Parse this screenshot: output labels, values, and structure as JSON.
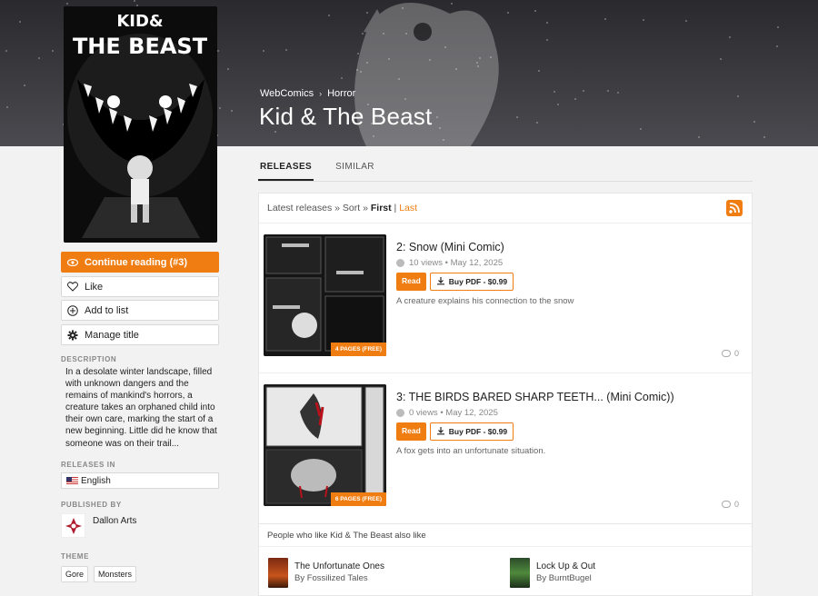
{
  "hero": {
    "breadcrumb": [
      "WebComics",
      "Horror"
    ],
    "title": "Kid & The Beast"
  },
  "cover": {
    "title_art_lines": [
      "KID&",
      "THE BEAST"
    ]
  },
  "actions": {
    "continue_label": "Continue reading (#3)",
    "like_label": "Like",
    "add_list_label": "Add to list",
    "manage_label": "Manage title"
  },
  "sidebar": {
    "description_label": "DESCRIPTION",
    "description": "In a desolate winter landscape, filled with unknown dangers and the remains of mankind's horrors, a creature takes an orphaned child into their own care, marking the start of a new beginning. Little did he know that someone was on their trail...",
    "releases_in_label": "RELEASES IN",
    "language": "English",
    "published_by_label": "PUBLISHED BY",
    "publisher": "Dallon Arts",
    "theme_label": "THEME",
    "tags": [
      "Gore",
      "Monsters"
    ]
  },
  "tabs": [
    {
      "label": "RELEASES",
      "active": true
    },
    {
      "label": "SIMILAR",
      "active": false
    }
  ],
  "releases_header": {
    "latest": "Latest releases",
    "sep1": "»",
    "sort": "Sort",
    "sep2": "»",
    "first": "First",
    "divider": "|",
    "last": "Last"
  },
  "releases": [
    {
      "title": "2: Snow (Mini Comic)",
      "meta": "10 views • May 12, 2025",
      "read_label": "Read",
      "pdf_label": "Buy PDF - $0.99",
      "description": "A creature explains his connection to the snow",
      "pages": "4 PAGES (FREE)",
      "comments": "0"
    },
    {
      "title": "3: THE BIRDS BARED SHARP TEETH... (Mini Comic))",
      "meta": "0 views • May 12, 2025",
      "read_label": "Read",
      "pdf_label": "Buy PDF - $0.99",
      "description": "A fox gets into an unfortunate situation.",
      "pages": "6 PAGES (FREE)",
      "comments": "0"
    }
  ],
  "similar": {
    "heading": "People who like Kid & The Beast also like",
    "items": [
      {
        "title": "The Unfortunate Ones",
        "by": "By Fossilized Tales"
      },
      {
        "title": "Lock Up & Out",
        "by": "By BurntBugel"
      }
    ]
  },
  "colors": {
    "accent": "#ef7d12",
    "hero_bg": "#2e2e33"
  }
}
